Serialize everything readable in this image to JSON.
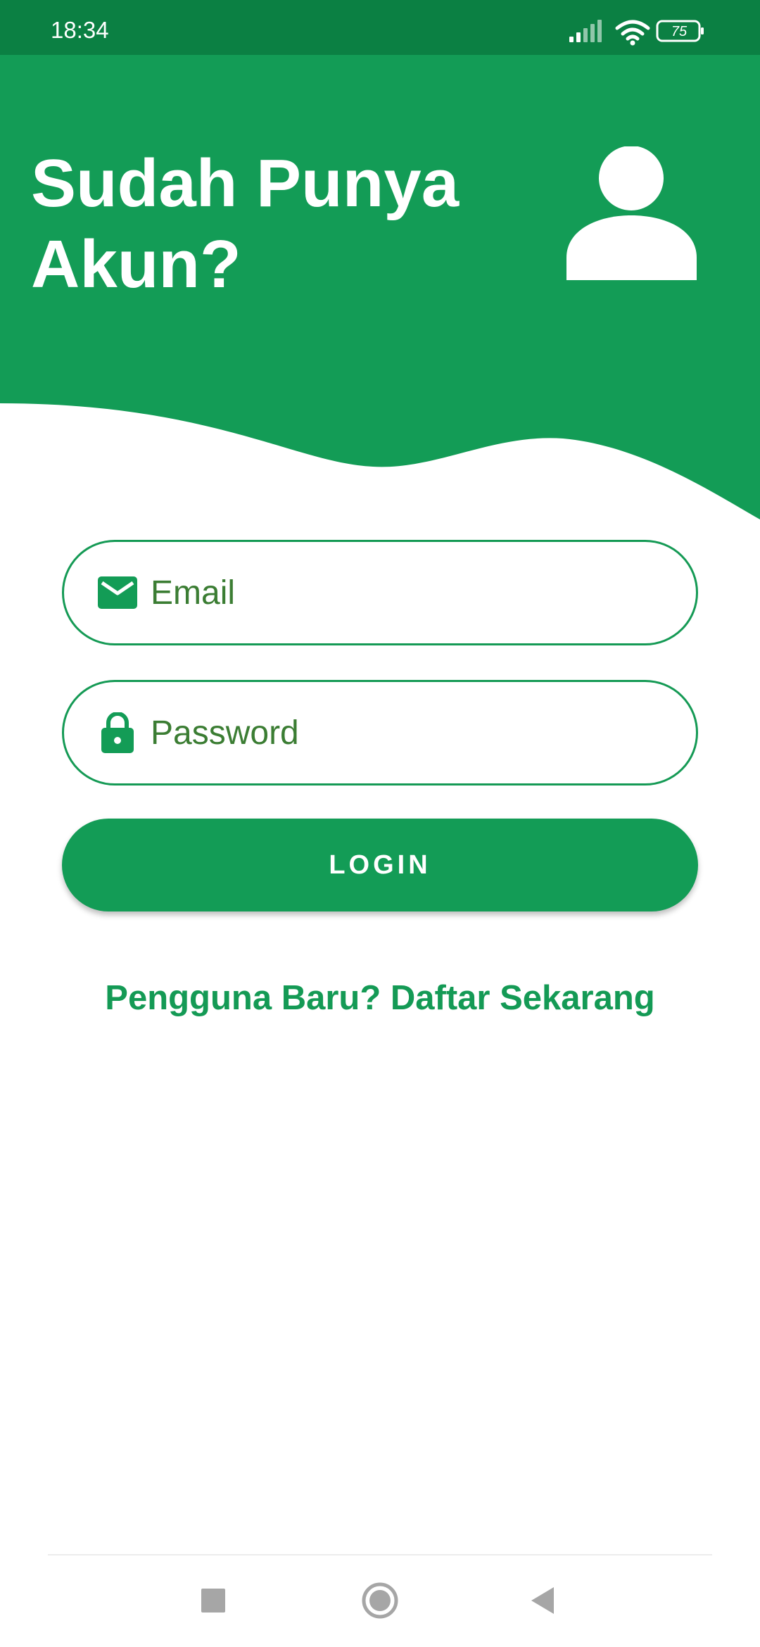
{
  "status_bar": {
    "time": "18:34",
    "battery_level": "75",
    "icons": [
      "signal-icon",
      "wifi-icon",
      "battery-icon"
    ]
  },
  "header": {
    "title": "Sudah Punya Akun?",
    "icon": "user-avatar-icon"
  },
  "form": {
    "email": {
      "placeholder": "Email",
      "value": "",
      "icon": "email-icon"
    },
    "password": {
      "placeholder": "Password",
      "value": "",
      "icon": "lock-icon"
    },
    "login_label": "LOGIN",
    "register_link": "Pengguna Baru? Daftar Sekarang"
  },
  "nav_bar": {
    "icons": [
      "recents-square-icon",
      "home-circle-icon",
      "back-triangle-icon"
    ]
  },
  "colors": {
    "status_bar": "#0b8043",
    "primary": "#139c56",
    "input_text": "#3b7d33",
    "background": "#ffffff"
  }
}
